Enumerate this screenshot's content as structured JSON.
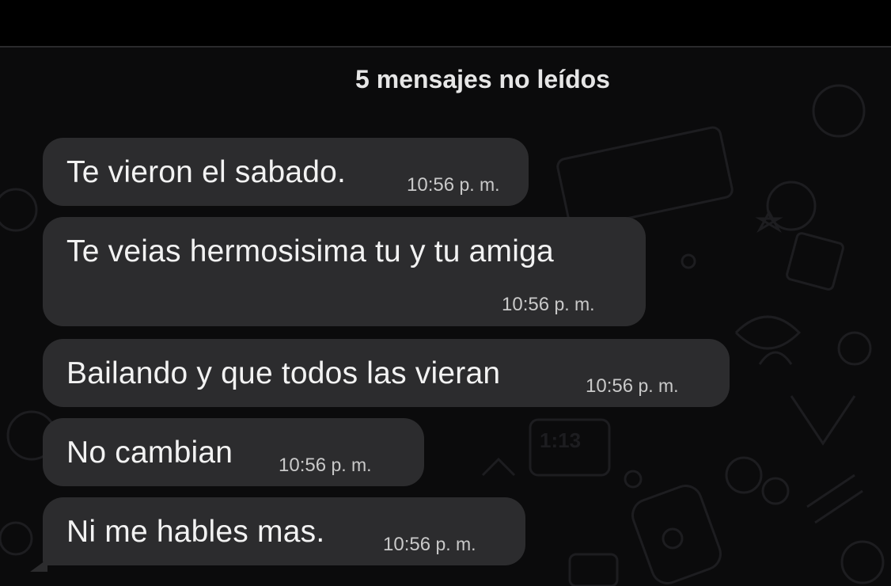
{
  "chat": {
    "unread_banner": "5 mensajes no leídos",
    "messages": [
      {
        "text": "Te vieron el sabado.",
        "time": "10:56",
        "meridiem": "p. m."
      },
      {
        "text": "Te veias hermosisima tu y tu amiga",
        "time": "10:56",
        "meridiem": "p. m."
      },
      {
        "text": "Bailando y que todos las vieran",
        "time": "10:56",
        "meridiem": "p. m."
      },
      {
        "text": "No cambian",
        "time": "10:56",
        "meridiem": "p. m."
      },
      {
        "text": "Ni me hables mas.",
        "time": "10:56",
        "meridiem": "p. m."
      }
    ]
  },
  "colors": {
    "background": "#000000",
    "chat_background": "#0b0b0c",
    "bubble": "#2c2c2e",
    "text": "#f2f2f2",
    "timestamp": "#c9c9c9"
  }
}
